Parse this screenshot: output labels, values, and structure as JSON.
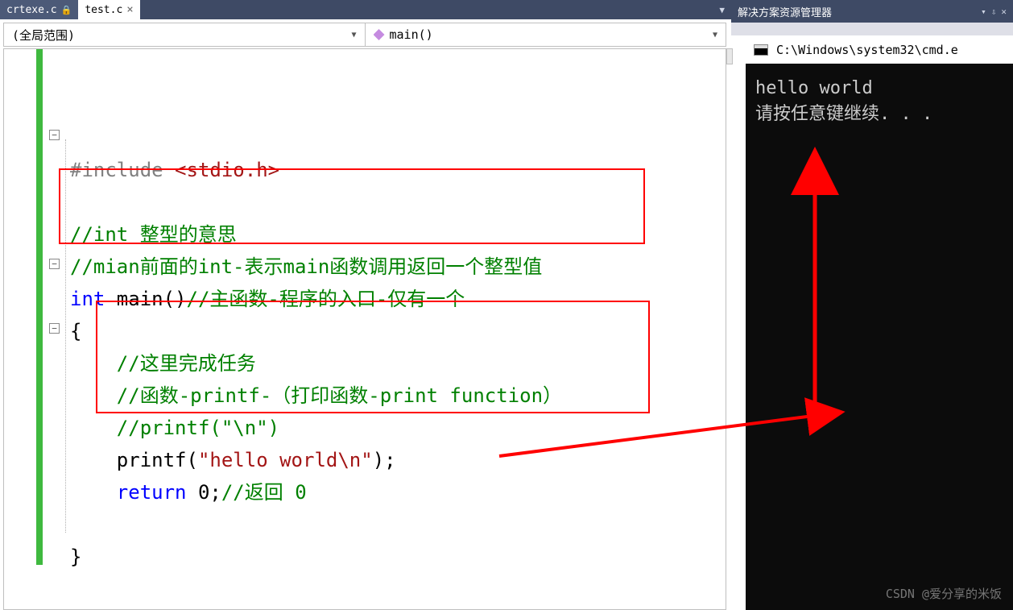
{
  "tabs": {
    "inactive": "crtexe.c",
    "active": "test.c"
  },
  "dropdown_arrow": "▼",
  "solution_explorer": {
    "title": "解决方案资源管理器",
    "pin": "⇩",
    "autohide": "✕"
  },
  "nav": {
    "scope": "(全局范围)",
    "member": "main()"
  },
  "code": {
    "l1_pp": "#include",
    "l1_inc": "<stdio.h>",
    "l3": "//int 整型的意思",
    "l4": "//mian前面的int-表示main函数调用返回一个整型值",
    "l5_kw": "int",
    "l5_fn": " main()",
    "l5_cm": "//主函数-程序的入口-仅有一个",
    "l6": "{",
    "l7": "//这里完成任务",
    "l8": "//函数-printf-（打印函数-print function）",
    "l9": "//printf(\"\\n\")",
    "l10_a": "printf(",
    "l10_s": "\"hello world\\n\"",
    "l10_b": ");",
    "l11_kw": "return",
    "l11_n": " 0;",
    "l11_cm": "//返回 0",
    "l13": "}"
  },
  "fold_minus": "−",
  "console": {
    "title": "C:\\Windows\\system32\\cmd.e",
    "line1": "hello world",
    "line2": "请按任意键继续. . ."
  },
  "watermark": "CSDN @爱分享的米饭"
}
